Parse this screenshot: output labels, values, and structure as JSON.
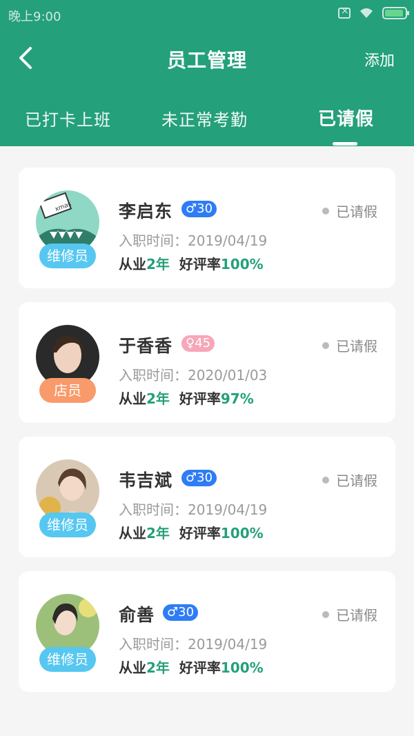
{
  "status_bar": {
    "time": "晚上9:00"
  },
  "header": {
    "title": "员工管理",
    "add_label": "添加"
  },
  "tabs": [
    {
      "label": "已打卡上班"
    },
    {
      "label": "未正常考勤"
    },
    {
      "label": "已请假"
    }
  ],
  "employees": [
    {
      "name": "李启东",
      "gender_symbol": "♂",
      "age": "30",
      "status": "已请假",
      "role": "维修员",
      "join_label": "入职时间",
      "join_date": "2019/04/19",
      "years_prefix": "从业",
      "years_value": "2年",
      "rating_label": "好评率",
      "rating_value": "100%"
    },
    {
      "name": "于香香",
      "gender_symbol": "♀",
      "age": "45",
      "status": "已请假",
      "role": "店员",
      "join_label": "入职时间",
      "join_date": "2020/01/03",
      "years_prefix": "从业",
      "years_value": "2年",
      "rating_label": "好评率",
      "rating_value": "97%"
    },
    {
      "name": "韦吉斌",
      "gender_symbol": "♂",
      "age": "30",
      "status": "已请假",
      "role": "维修员",
      "join_label": "入职时间",
      "join_date": "2019/04/19",
      "years_prefix": "从业",
      "years_value": "2年",
      "rating_label": "好评率",
      "rating_value": "100%"
    },
    {
      "name": "俞善",
      "gender_symbol": "♂",
      "age": "30",
      "status": "已请假",
      "role": "维修员",
      "join_label": "入职时间",
      "join_date": "2019/04/19",
      "years_prefix": "从业",
      "years_value": "2年",
      "rating_label": "好评率",
      "rating_value": "100%"
    }
  ],
  "avatar_1_text": "xmas",
  "colors": {
    "primary": "#24a07a",
    "male": "#2e7cf6",
    "female": "#f7a6b8",
    "role_repair": "#56c7f0",
    "role_clerk": "#f99a6a"
  }
}
